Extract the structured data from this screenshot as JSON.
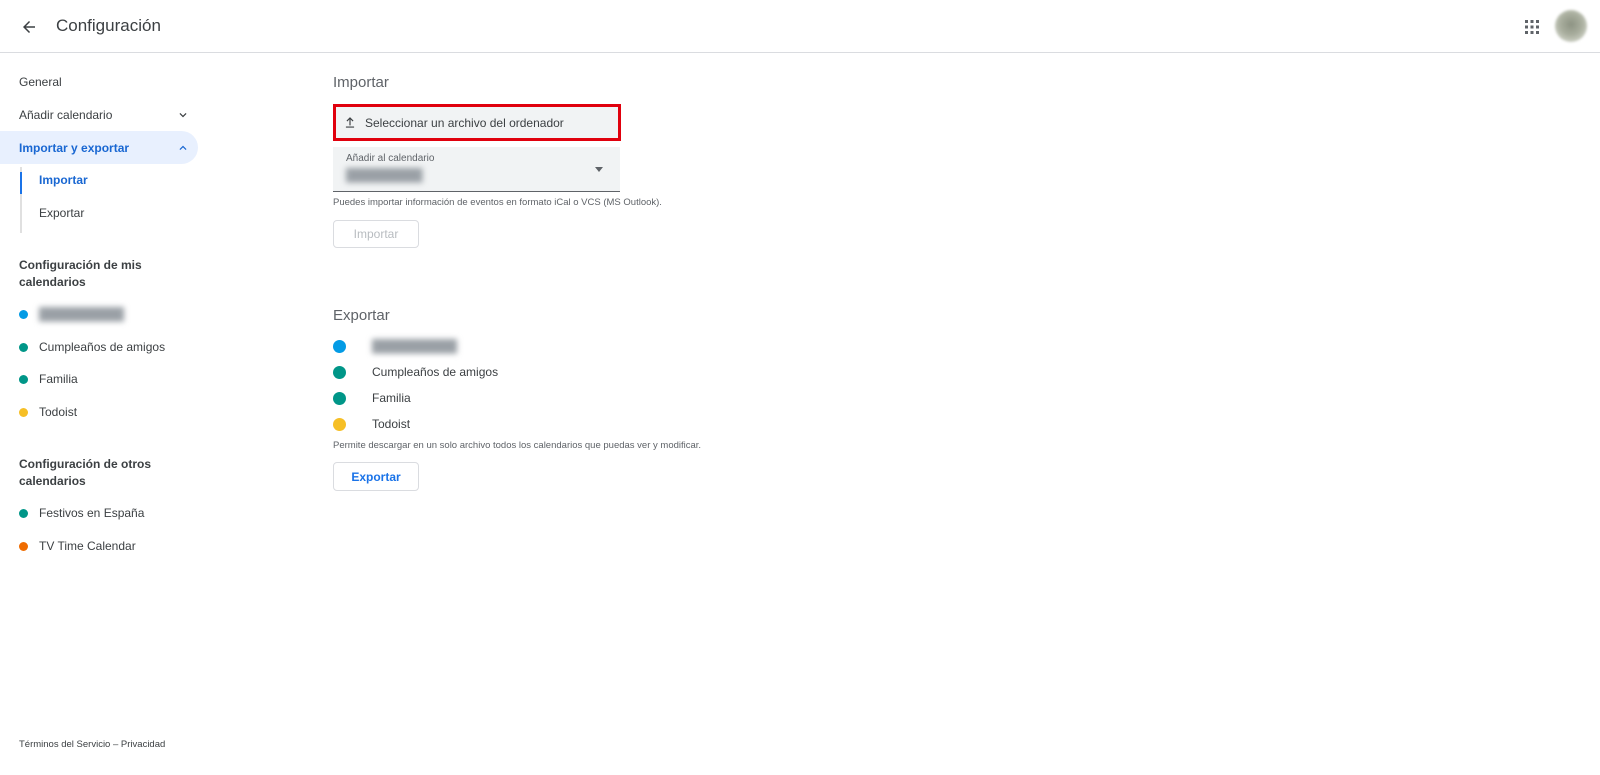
{
  "header": {
    "title": "Configuración"
  },
  "sidebar": {
    "general": "General",
    "add_calendar": "Añadir calendario",
    "import_export": "Importar y exportar",
    "sub": {
      "import": "Importar",
      "export": "Exportar"
    },
    "my_calendars_heading": "Configuración de mis calendarios",
    "my_calendars": [
      {
        "label": "",
        "color": "#039be5"
      },
      {
        "label": "Cumpleaños de amigos",
        "color": "#009688"
      },
      {
        "label": "Familia",
        "color": "#009688"
      },
      {
        "label": "Todoist",
        "color": "#f6bf26"
      }
    ],
    "other_calendars_heading": "Configuración de otros calendarios",
    "other_calendars": [
      {
        "label": "Festivos en España",
        "color": "#009688"
      },
      {
        "label": "TV Time Calendar",
        "color": "#ef6c00"
      }
    ]
  },
  "import": {
    "title": "Importar",
    "select_file_label": "Seleccionar un archivo del ordenador",
    "calendar_select_label": "Añadir al calendario",
    "calendar_select_value": "",
    "help": "Puedes importar información de eventos en formato iCal o VCS (MS Outlook).",
    "button": "Importar"
  },
  "export": {
    "title": "Exportar",
    "items": [
      {
        "label": "",
        "color": "#039be5"
      },
      {
        "label": "Cumpleaños de amigos",
        "color": "#009688"
      },
      {
        "label": "Familia",
        "color": "#009688"
      },
      {
        "label": "Todoist",
        "color": "#f6bf26"
      }
    ],
    "help": "Permite descargar en un solo archivo todos los calendarios que puedas ver y modificar.",
    "button": "Exportar"
  },
  "footer": {
    "terms": "Términos del Servicio",
    "separator": "–",
    "privacy": "Privacidad"
  }
}
